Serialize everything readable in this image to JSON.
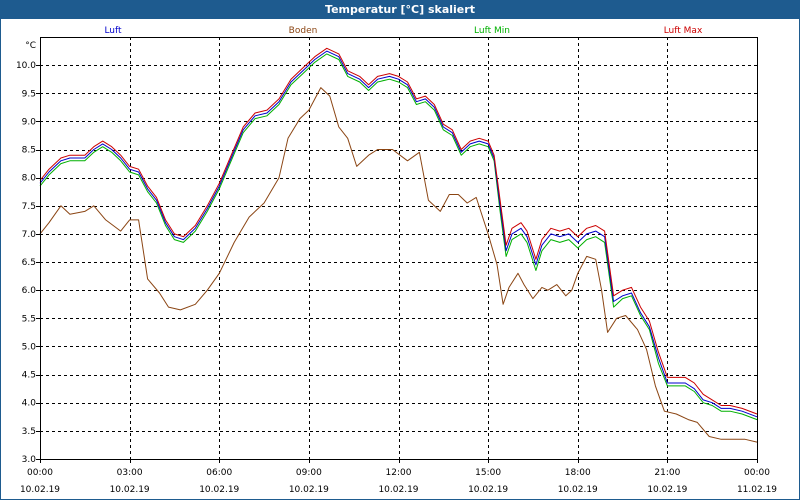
{
  "window": {
    "title": "Temperatur [°C] skaliert"
  },
  "chart_data": {
    "type": "line",
    "title": "Temperatur [°C] skaliert",
    "ylabel": "°C",
    "xlabel": "",
    "ylim": [
      3.0,
      10.5
    ],
    "xlim": [
      0,
      24
    ],
    "grid": true,
    "legend_position": "top",
    "y_ticks": [
      "3.0",
      "3.5",
      "4.0",
      "4.5",
      "5.0",
      "5.5",
      "6.0",
      "6.5",
      "7.0",
      "7.5",
      "8.0",
      "8.5",
      "9.0",
      "9.5",
      "10.0"
    ],
    "x_ticks": [
      {
        "time": "00:00",
        "date": "10.02.19"
      },
      {
        "time": "03:00",
        "date": "10.02.19"
      },
      {
        "time": "06:00",
        "date": "10.02.19"
      },
      {
        "time": "09:00",
        "date": "10.02.19"
      },
      {
        "time": "12:00",
        "date": "10.02.19"
      },
      {
        "time": "15:00",
        "date": "10.02.19"
      },
      {
        "time": "18:00",
        "date": "10.02.19"
      },
      {
        "time": "21:00",
        "date": "10.02.19"
      },
      {
        "time": "00:00",
        "date": "11.02.19"
      }
    ],
    "series": [
      {
        "name": "Boden",
        "color": "#8b4513",
        "points": [
          [
            0,
            7.0
          ],
          [
            0.3,
            7.2
          ],
          [
            0.7,
            7.5
          ],
          [
            1.0,
            7.35
          ],
          [
            1.5,
            7.4
          ],
          [
            1.8,
            7.5
          ],
          [
            2.2,
            7.25
          ],
          [
            2.7,
            7.05
          ],
          [
            3.0,
            7.25
          ],
          [
            3.3,
            7.25
          ],
          [
            3.6,
            6.2
          ],
          [
            4.0,
            5.95
          ],
          [
            4.3,
            5.7
          ],
          [
            4.7,
            5.65
          ],
          [
            5.2,
            5.75
          ],
          [
            5.6,
            6.0
          ],
          [
            6.0,
            6.3
          ],
          [
            6.5,
            6.85
          ],
          [
            7.0,
            7.3
          ],
          [
            7.5,
            7.55
          ],
          [
            8.0,
            8.0
          ],
          [
            8.3,
            8.7
          ],
          [
            8.7,
            9.05
          ],
          [
            9.0,
            9.2
          ],
          [
            9.4,
            9.6
          ],
          [
            9.7,
            9.45
          ],
          [
            10.0,
            8.9
          ],
          [
            10.3,
            8.7
          ],
          [
            10.6,
            8.2
          ],
          [
            11.0,
            8.4
          ],
          [
            11.3,
            8.5
          ],
          [
            11.8,
            8.5
          ],
          [
            12.3,
            8.3
          ],
          [
            12.7,
            8.45
          ],
          [
            13.0,
            7.6
          ],
          [
            13.4,
            7.4
          ],
          [
            13.7,
            7.7
          ],
          [
            14.0,
            7.7
          ],
          [
            14.3,
            7.55
          ],
          [
            14.6,
            7.65
          ],
          [
            15.0,
            7.0
          ],
          [
            15.3,
            6.45
          ],
          [
            15.5,
            5.75
          ],
          [
            15.7,
            6.05
          ],
          [
            16.0,
            6.3
          ],
          [
            16.2,
            6.1
          ],
          [
            16.5,
            5.85
          ],
          [
            16.8,
            6.05
          ],
          [
            17.0,
            6.0
          ],
          [
            17.3,
            6.1
          ],
          [
            17.6,
            5.9
          ],
          [
            17.8,
            6.0
          ],
          [
            18.0,
            6.3
          ],
          [
            18.3,
            6.6
          ],
          [
            18.6,
            6.55
          ],
          [
            18.8,
            6.0
          ],
          [
            19.0,
            5.25
          ],
          [
            19.3,
            5.5
          ],
          [
            19.6,
            5.55
          ],
          [
            20.0,
            5.3
          ],
          [
            20.3,
            4.95
          ],
          [
            20.6,
            4.3
          ],
          [
            20.9,
            3.85
          ],
          [
            21.3,
            3.8
          ],
          [
            21.7,
            3.7
          ],
          [
            22.0,
            3.65
          ],
          [
            22.4,
            3.4
          ],
          [
            22.8,
            3.35
          ],
          [
            23.2,
            3.35
          ],
          [
            23.6,
            3.35
          ],
          [
            24.0,
            3.3
          ]
        ]
      },
      {
        "name": "Luft Min",
        "color": "#00b000",
        "points": [
          [
            0,
            7.85
          ],
          [
            0.3,
            8.05
          ],
          [
            0.7,
            8.25
          ],
          [
            1.0,
            8.3
          ],
          [
            1.5,
            8.3
          ],
          [
            1.8,
            8.45
          ],
          [
            2.1,
            8.55
          ],
          [
            2.4,
            8.45
          ],
          [
            2.7,
            8.3
          ],
          [
            3.0,
            8.1
          ],
          [
            3.3,
            8.05
          ],
          [
            3.6,
            7.75
          ],
          [
            3.9,
            7.55
          ],
          [
            4.2,
            7.15
          ],
          [
            4.5,
            6.9
          ],
          [
            4.8,
            6.85
          ],
          [
            5.2,
            7.05
          ],
          [
            5.6,
            7.4
          ],
          [
            6.0,
            7.8
          ],
          [
            6.4,
            8.3
          ],
          [
            6.8,
            8.8
          ],
          [
            7.2,
            9.05
          ],
          [
            7.6,
            9.1
          ],
          [
            8.0,
            9.3
          ],
          [
            8.4,
            9.65
          ],
          [
            8.8,
            9.85
          ],
          [
            9.2,
            10.05
          ],
          [
            9.6,
            10.2
          ],
          [
            10.0,
            10.1
          ],
          [
            10.3,
            9.8
          ],
          [
            10.7,
            9.7
          ],
          [
            11.0,
            9.55
          ],
          [
            11.3,
            9.7
          ],
          [
            11.7,
            9.75
          ],
          [
            12.0,
            9.7
          ],
          [
            12.3,
            9.6
          ],
          [
            12.6,
            9.3
          ],
          [
            12.9,
            9.35
          ],
          [
            13.2,
            9.2
          ],
          [
            13.5,
            8.85
          ],
          [
            13.8,
            8.75
          ],
          [
            14.1,
            8.4
          ],
          [
            14.4,
            8.55
          ],
          [
            14.7,
            8.6
          ],
          [
            15.0,
            8.55
          ],
          [
            15.2,
            8.3
          ],
          [
            15.4,
            7.4
          ],
          [
            15.6,
            6.6
          ],
          [
            15.8,
            6.9
          ],
          [
            16.1,
            7.0
          ],
          [
            16.3,
            6.85
          ],
          [
            16.6,
            6.35
          ],
          [
            16.8,
            6.7
          ],
          [
            17.1,
            6.9
          ],
          [
            17.4,
            6.85
          ],
          [
            17.7,
            6.9
          ],
          [
            18.0,
            6.75
          ],
          [
            18.3,
            6.9
          ],
          [
            18.6,
            6.95
          ],
          [
            18.9,
            6.85
          ],
          [
            19.2,
            5.7
          ],
          [
            19.5,
            5.85
          ],
          [
            19.8,
            5.9
          ],
          [
            20.1,
            5.55
          ],
          [
            20.4,
            5.3
          ],
          [
            20.7,
            4.7
          ],
          [
            21.0,
            4.3
          ],
          [
            21.3,
            4.3
          ],
          [
            21.6,
            4.3
          ],
          [
            21.9,
            4.2
          ],
          [
            22.2,
            4.0
          ],
          [
            22.5,
            3.95
          ],
          [
            22.8,
            3.85
          ],
          [
            23.1,
            3.85
          ],
          [
            23.5,
            3.8
          ],
          [
            24.0,
            3.7
          ]
        ]
      },
      {
        "name": "Luft",
        "color": "#0000cc",
        "points": [
          [
            0,
            7.9
          ],
          [
            0.3,
            8.1
          ],
          [
            0.7,
            8.3
          ],
          [
            1.0,
            8.35
          ],
          [
            1.5,
            8.35
          ],
          [
            1.8,
            8.5
          ],
          [
            2.1,
            8.6
          ],
          [
            2.4,
            8.5
          ],
          [
            2.7,
            8.35
          ],
          [
            3.0,
            8.15
          ],
          [
            3.3,
            8.1
          ],
          [
            3.6,
            7.8
          ],
          [
            3.9,
            7.6
          ],
          [
            4.2,
            7.2
          ],
          [
            4.5,
            6.95
          ],
          [
            4.8,
            6.9
          ],
          [
            5.2,
            7.1
          ],
          [
            5.6,
            7.45
          ],
          [
            6.0,
            7.85
          ],
          [
            6.4,
            8.35
          ],
          [
            6.8,
            8.85
          ],
          [
            7.2,
            9.1
          ],
          [
            7.6,
            9.15
          ],
          [
            8.0,
            9.35
          ],
          [
            8.4,
            9.7
          ],
          [
            8.8,
            9.9
          ],
          [
            9.2,
            10.1
          ],
          [
            9.6,
            10.25
          ],
          [
            10.0,
            10.15
          ],
          [
            10.3,
            9.85
          ],
          [
            10.7,
            9.75
          ],
          [
            11.0,
            9.6
          ],
          [
            11.3,
            9.75
          ],
          [
            11.7,
            9.8
          ],
          [
            12.0,
            9.75
          ],
          [
            12.3,
            9.65
          ],
          [
            12.6,
            9.35
          ],
          [
            12.9,
            9.4
          ],
          [
            13.2,
            9.25
          ],
          [
            13.5,
            8.9
          ],
          [
            13.8,
            8.8
          ],
          [
            14.1,
            8.45
          ],
          [
            14.4,
            8.6
          ],
          [
            14.7,
            8.65
          ],
          [
            15.0,
            8.6
          ],
          [
            15.2,
            8.35
          ],
          [
            15.4,
            7.5
          ],
          [
            15.6,
            6.7
          ],
          [
            15.8,
            7.0
          ],
          [
            16.1,
            7.1
          ],
          [
            16.3,
            6.95
          ],
          [
            16.6,
            6.45
          ],
          [
            16.8,
            6.8
          ],
          [
            17.1,
            7.0
          ],
          [
            17.4,
            6.95
          ],
          [
            17.7,
            7.0
          ],
          [
            18.0,
            6.85
          ],
          [
            18.3,
            7.0
          ],
          [
            18.6,
            7.05
          ],
          [
            18.9,
            6.95
          ],
          [
            19.2,
            5.8
          ],
          [
            19.5,
            5.9
          ],
          [
            19.8,
            5.95
          ],
          [
            20.1,
            5.6
          ],
          [
            20.4,
            5.35
          ],
          [
            20.7,
            4.8
          ],
          [
            21.0,
            4.35
          ],
          [
            21.3,
            4.35
          ],
          [
            21.6,
            4.35
          ],
          [
            21.9,
            4.25
          ],
          [
            22.2,
            4.05
          ],
          [
            22.5,
            4.0
          ],
          [
            22.8,
            3.9
          ],
          [
            23.1,
            3.9
          ],
          [
            23.5,
            3.85
          ],
          [
            24.0,
            3.75
          ]
        ]
      },
      {
        "name": "Luft Max",
        "color": "#cc0000",
        "points": [
          [
            0,
            7.95
          ],
          [
            0.3,
            8.15
          ],
          [
            0.7,
            8.35
          ],
          [
            1.0,
            8.4
          ],
          [
            1.5,
            8.4
          ],
          [
            1.8,
            8.55
          ],
          [
            2.1,
            8.65
          ],
          [
            2.4,
            8.55
          ],
          [
            2.7,
            8.4
          ],
          [
            3.0,
            8.2
          ],
          [
            3.3,
            8.15
          ],
          [
            3.6,
            7.85
          ],
          [
            3.9,
            7.65
          ],
          [
            4.2,
            7.25
          ],
          [
            4.5,
            7.0
          ],
          [
            4.8,
            6.95
          ],
          [
            5.2,
            7.15
          ],
          [
            5.6,
            7.5
          ],
          [
            6.0,
            7.9
          ],
          [
            6.4,
            8.4
          ],
          [
            6.8,
            8.9
          ],
          [
            7.2,
            9.15
          ],
          [
            7.6,
            9.2
          ],
          [
            8.0,
            9.4
          ],
          [
            8.4,
            9.75
          ],
          [
            8.8,
            9.95
          ],
          [
            9.2,
            10.15
          ],
          [
            9.6,
            10.3
          ],
          [
            10.0,
            10.2
          ],
          [
            10.3,
            9.9
          ],
          [
            10.7,
            9.8
          ],
          [
            11.0,
            9.65
          ],
          [
            11.3,
            9.8
          ],
          [
            11.7,
            9.85
          ],
          [
            12.0,
            9.8
          ],
          [
            12.3,
            9.7
          ],
          [
            12.6,
            9.4
          ],
          [
            12.9,
            9.45
          ],
          [
            13.2,
            9.3
          ],
          [
            13.5,
            8.95
          ],
          [
            13.8,
            8.85
          ],
          [
            14.1,
            8.5
          ],
          [
            14.4,
            8.65
          ],
          [
            14.7,
            8.7
          ],
          [
            15.0,
            8.65
          ],
          [
            15.2,
            8.4
          ],
          [
            15.4,
            7.6
          ],
          [
            15.6,
            6.8
          ],
          [
            15.8,
            7.1
          ],
          [
            16.1,
            7.2
          ],
          [
            16.3,
            7.05
          ],
          [
            16.6,
            6.55
          ],
          [
            16.8,
            6.9
          ],
          [
            17.1,
            7.1
          ],
          [
            17.4,
            7.05
          ],
          [
            17.7,
            7.1
          ],
          [
            18.0,
            6.95
          ],
          [
            18.3,
            7.1
          ],
          [
            18.6,
            7.15
          ],
          [
            18.9,
            7.05
          ],
          [
            19.2,
            5.9
          ],
          [
            19.5,
            6.0
          ],
          [
            19.8,
            6.05
          ],
          [
            20.1,
            5.7
          ],
          [
            20.4,
            5.45
          ],
          [
            20.7,
            4.9
          ],
          [
            21.0,
            4.45
          ],
          [
            21.3,
            4.45
          ],
          [
            21.6,
            4.45
          ],
          [
            21.9,
            4.35
          ],
          [
            22.2,
            4.15
          ],
          [
            22.5,
            4.05
          ],
          [
            22.8,
            3.95
          ],
          [
            23.1,
            3.95
          ],
          [
            23.5,
            3.9
          ],
          [
            24.0,
            3.8
          ]
        ]
      }
    ]
  }
}
